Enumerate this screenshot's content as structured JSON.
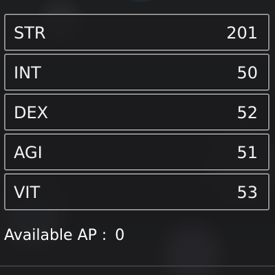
{
  "stats": [
    {
      "label": "STR",
      "value": "201"
    },
    {
      "label": "INT",
      "value": "50"
    },
    {
      "label": "DEX",
      "value": "52"
    },
    {
      "label": "AGI",
      "value": "51"
    },
    {
      "label": "VIT",
      "value": "53"
    }
  ],
  "ap": {
    "label": "Available AP :",
    "value": "0"
  },
  "colors": {
    "row_border": "#8f8f8f",
    "row_background": "#1c1c1f",
    "text": "#f2f2f2"
  }
}
